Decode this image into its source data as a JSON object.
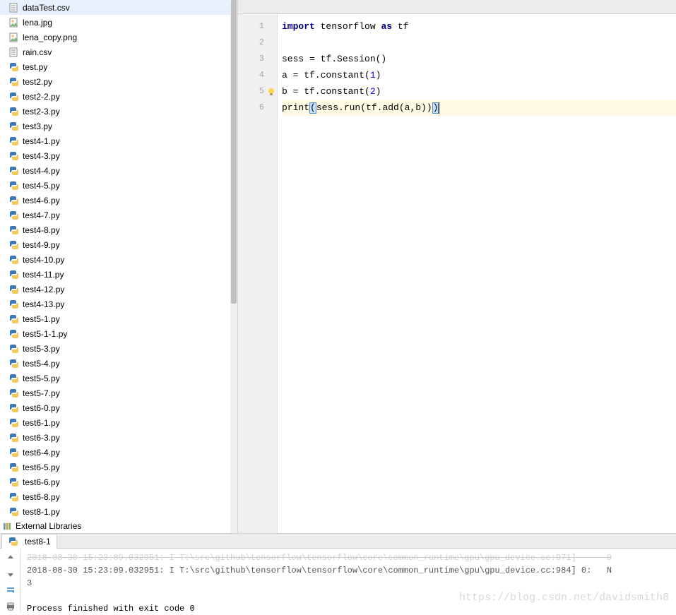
{
  "sidebar": {
    "files": [
      {
        "name": "dataTest.csv",
        "type": "csv"
      },
      {
        "name": "lena.jpg",
        "type": "img"
      },
      {
        "name": "lena_copy.png",
        "type": "img"
      },
      {
        "name": "rain.csv",
        "type": "csv"
      },
      {
        "name": "test.py",
        "type": "py"
      },
      {
        "name": "test2.py",
        "type": "py"
      },
      {
        "name": "test2-2.py",
        "type": "py"
      },
      {
        "name": "test2-3.py",
        "type": "py"
      },
      {
        "name": "test3.py",
        "type": "py"
      },
      {
        "name": "test4-1.py",
        "type": "py"
      },
      {
        "name": "test4-3.py",
        "type": "py"
      },
      {
        "name": "test4-4.py",
        "type": "py"
      },
      {
        "name": "test4-5.py",
        "type": "py"
      },
      {
        "name": "test4-6.py",
        "type": "py"
      },
      {
        "name": "test4-7.py",
        "type": "py"
      },
      {
        "name": "test4-8.py",
        "type": "py"
      },
      {
        "name": "test4-9.py",
        "type": "py"
      },
      {
        "name": "test4-10.py",
        "type": "py"
      },
      {
        "name": "test4-11.py",
        "type": "py"
      },
      {
        "name": "test4-12.py",
        "type": "py"
      },
      {
        "name": "test4-13.py",
        "type": "py"
      },
      {
        "name": "test5-1.py",
        "type": "py"
      },
      {
        "name": "test5-1-1.py",
        "type": "py"
      },
      {
        "name": "test5-3.py",
        "type": "py"
      },
      {
        "name": "test5-4.py",
        "type": "py"
      },
      {
        "name": "test5-5.py",
        "type": "py"
      },
      {
        "name": "test5-7.py",
        "type": "py"
      },
      {
        "name": "test6-0.py",
        "type": "py"
      },
      {
        "name": "test6-1.py",
        "type": "py"
      },
      {
        "name": "test6-3.py",
        "type": "py"
      },
      {
        "name": "test6-4.py",
        "type": "py"
      },
      {
        "name": "test6-5.py",
        "type": "py"
      },
      {
        "name": "test6-6.py",
        "type": "py"
      },
      {
        "name": "test6-8.py",
        "type": "py"
      },
      {
        "name": "test8-1.py",
        "type": "py"
      }
    ],
    "external_libraries": "External Libraries"
  },
  "editor": {
    "gutter": [
      "1",
      "2",
      "3",
      "4",
      "5",
      "6"
    ],
    "lines": {
      "l1": {
        "kw1": "import",
        "sp1": " tensorflow ",
        "kw2": "as",
        "sp2": " tf"
      },
      "l3": "sess = tf.Session()",
      "l4": {
        "pre": "a = tf.constant(",
        "num": "1",
        "post": ")"
      },
      "l5": {
        "pre": "b = tf.constant(",
        "num": "2",
        "post": ")"
      },
      "l6": {
        "fn": "print",
        "open": "(",
        "mid": "sess.run(tf.add(a,b))",
        "close": ")"
      }
    },
    "bulb_line": 5
  },
  "tab": {
    "label": "test8-1"
  },
  "console": {
    "line1_dim": "2018-08-30 15:23:09.032951: I T:\\src\\github\\tensorflow\\tensorflow\\core\\common_runtime\\gpu\\gpu_device.cc:971]      0",
    "line2": "2018-08-30 15:23:09.032951: I T:\\src\\github\\tensorflow\\tensorflow\\core\\common_runtime\\gpu\\gpu_device.cc:984] 0:   N",
    "line3": "3",
    "exit": "Process finished with exit code 0"
  },
  "watermark": "https://blog.csdn.net/davidsmith8"
}
